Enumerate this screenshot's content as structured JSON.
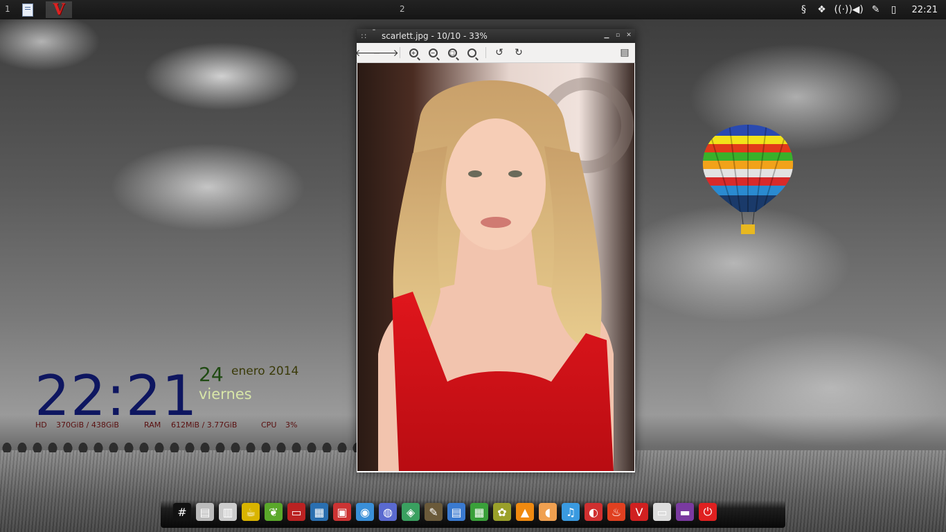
{
  "panel": {
    "workspaces": [
      "1",
      "2"
    ],
    "clock": "22:21",
    "tray_icons": [
      "steam-icon",
      "dropbox-icon",
      "wireless-icon",
      "volume-icon",
      "pen-icon",
      "battery-icon"
    ]
  },
  "desktop_widget": {
    "time": "22:21",
    "day": "24",
    "month_year": "enero 2014",
    "weekday": "viernes",
    "hd_label": "HD",
    "hd_value": "370GiB  / 438GiB",
    "ram_label": "RAM",
    "ram_value": "612MiB  / 3.77GiB",
    "cpu_label": "CPU",
    "cpu_value": "3%",
    "colors": {
      "time": "#0e1660",
      "day": "#1f4a12",
      "weekday": "#d8e6a8",
      "stats": "#5a0f0f"
    }
  },
  "viewer": {
    "title": "scarlett.jpg - 10/10 - 33%",
    "toolbar": [
      "back-arrow-icon",
      "forward-arrow-icon",
      "zoom-in-icon",
      "zoom-out-icon",
      "zoom-fit-icon",
      "zoom-original-icon",
      "rotate-left-icon",
      "rotate-right-icon",
      "sidebar-panel-icon"
    ]
  },
  "dock": {
    "items": [
      {
        "name": "terminal-icon",
        "glyph": "#",
        "color": "#111"
      },
      {
        "name": "printer-icon",
        "glyph": "▤",
        "color": "#bbb"
      },
      {
        "name": "file-manager-icon",
        "glyph": "▥",
        "color": "#ccc"
      },
      {
        "name": "teapot-icon",
        "glyph": "☕",
        "color": "#d9b400"
      },
      {
        "name": "leaf-icon",
        "glyph": "❦",
        "color": "#5aa82a"
      },
      {
        "name": "presentation-icon",
        "glyph": "▭",
        "color": "#b22"
      },
      {
        "name": "calculator-icon",
        "glyph": "▦",
        "color": "#2a6fb0"
      },
      {
        "name": "package-icon",
        "glyph": "▣",
        "color": "#c33"
      },
      {
        "name": "chromium-icon",
        "glyph": "◉",
        "color": "#3a8fd8"
      },
      {
        "name": "web-browser-icon",
        "glyph": "◍",
        "color": "#5a6ad0"
      },
      {
        "name": "map-icon",
        "glyph": "◈",
        "color": "#3aa060"
      },
      {
        "name": "gimp-icon",
        "glyph": "✎",
        "color": "#6b5a3a"
      },
      {
        "name": "writer-icon",
        "glyph": "▤",
        "color": "#3a7ad0"
      },
      {
        "name": "spreadsheet-icon",
        "glyph": "▦",
        "color": "#3aa03a"
      },
      {
        "name": "image-viewer-icon",
        "glyph": "✿",
        "color": "#9aa02a"
      },
      {
        "name": "vlc-icon",
        "glyph": "▲",
        "color": "#f08a10"
      },
      {
        "name": "music-player-icon",
        "glyph": "◖",
        "color": "#f0a050"
      },
      {
        "name": "audio-icon",
        "glyph": "♫",
        "color": "#3a9ae0"
      },
      {
        "name": "media-icon",
        "glyph": "◐",
        "color": "#d03030"
      },
      {
        "name": "burner-icon",
        "glyph": "♨",
        "color": "#e04020"
      },
      {
        "name": "v-app-icon",
        "glyph": "V",
        "color": "#d02020"
      },
      {
        "name": "screen-icon",
        "glyph": "▭",
        "color": "#ddd"
      },
      {
        "name": "workspace-switcher-icon",
        "glyph": "▬",
        "color": "#7a3aa0"
      },
      {
        "name": "power-icon",
        "glyph": "⏻",
        "color": "#e02020"
      }
    ]
  }
}
